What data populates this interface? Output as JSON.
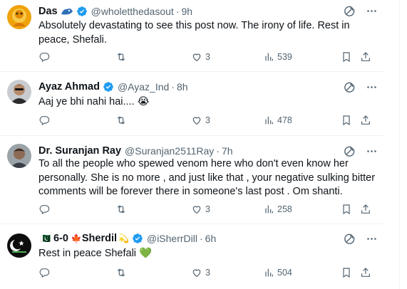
{
  "tweets": [
    {
      "name": "Das",
      "name_emojis": "",
      "handle": "@wholetthedasout",
      "time": "9h",
      "text": "Absolutely devastating to see this post now. The irony of life. Rest in peace, Shefali.",
      "replies": "",
      "retweets": "",
      "likes": "3",
      "views": "539"
    },
    {
      "name": "Ayaz Ahmad",
      "name_emojis": "",
      "handle": "@Ayaz_Ind",
      "time": "8h",
      "text": "Aaj ye bhi nahi hai.... 😭",
      "replies": "",
      "retweets": "",
      "likes": "3",
      "views": "478"
    },
    {
      "name": "Dr. Suranjan Ray",
      "name_emojis": "",
      "handle": "@Suranjan2511Ray",
      "time": "7h",
      "text": "To all the people who spewed venom here who don't even know her personally. She is no more , and just like that , your negative sulking bitter comments will be forever there in someone's last post . Om shanti.",
      "replies": "",
      "retweets": "",
      "likes": "3",
      "views": "258"
    },
    {
      "name": "6-0",
      "name_prefix": "🇵🇰",
      "name_mid": "🍁",
      "name2": "Sherdil",
      "name_emojis": "💫",
      "handle": "@iSherrDill",
      "time": "6h",
      "text": "Rest in peace Shefali 💚",
      "replies": "",
      "retweets": "",
      "likes": "3",
      "views": "504"
    }
  ],
  "separator": "·",
  "colors": {
    "verified": "#1d9bf0",
    "text": "#0f1419",
    "secondary": "#536471",
    "divider": "#eff3f4"
  },
  "icons": [
    "reply-icon",
    "retweet-icon",
    "like-icon",
    "views-icon",
    "bookmark-icon",
    "share-icon",
    "grok-icon",
    "more-icon"
  ]
}
